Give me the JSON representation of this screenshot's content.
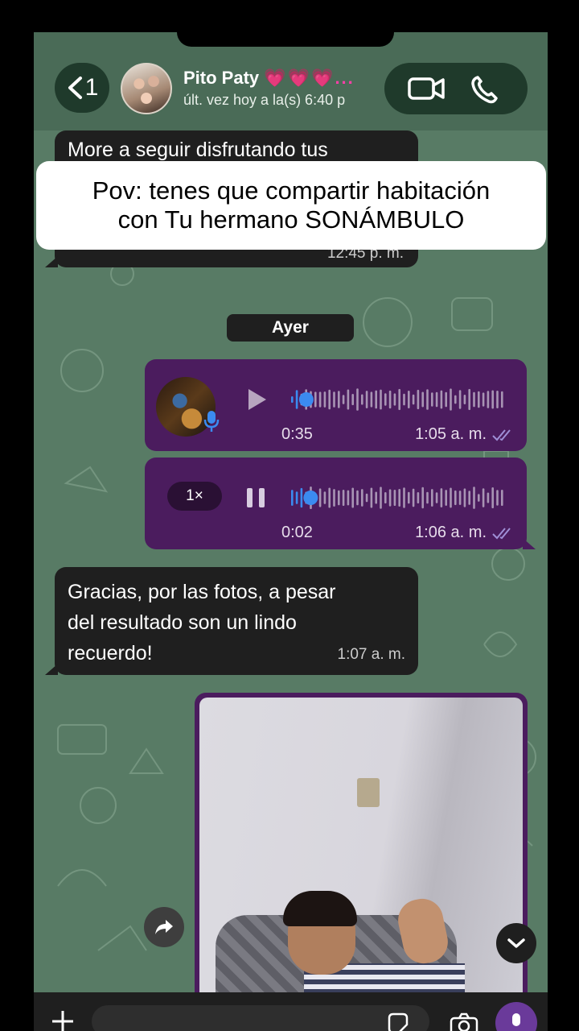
{
  "header": {
    "back_count": "1",
    "contact_name": "Pito Paty",
    "contact_hearts": "💗💗💗...",
    "last_seen": "últ. vez hoy a la(s) 6:40 p"
  },
  "overlay": {
    "line1": "Pov: tenes que compartir habitación",
    "line2": "con Tu hermano SONÁMBULO"
  },
  "messages": {
    "top_text": "More a seguir disfrutando tus",
    "top_time": "12:45 p. m.",
    "date_separator": "Ayer",
    "voice1": {
      "duration": "0:35",
      "time": "1:05 a. m.",
      "progress": 0.04
    },
    "voice2": {
      "speed": "1×",
      "duration": "0:02",
      "time": "1:06 a. m.",
      "progress": 0.06
    },
    "text_msg": {
      "line1": "Gracias, por las fotos, a pesar",
      "line2": "del resultado son un lindo",
      "line3": "recuerdo!",
      "time": "1:07 a. m."
    }
  },
  "colors": {
    "background": "#587b65",
    "incoming_bubble": "#1f1f1f",
    "outgoing_bubble": "#4b1c5e",
    "accent_blue": "#3b8bf0",
    "hearts": "#ff3fa8"
  },
  "icons": [
    "back-chevron-icon",
    "video-call-icon",
    "phone-call-icon",
    "play-icon",
    "pause-icon",
    "mic-icon",
    "double-check-icon",
    "forward-icon",
    "chevron-down-icon",
    "plus-icon",
    "sticker-icon",
    "camera-icon"
  ]
}
